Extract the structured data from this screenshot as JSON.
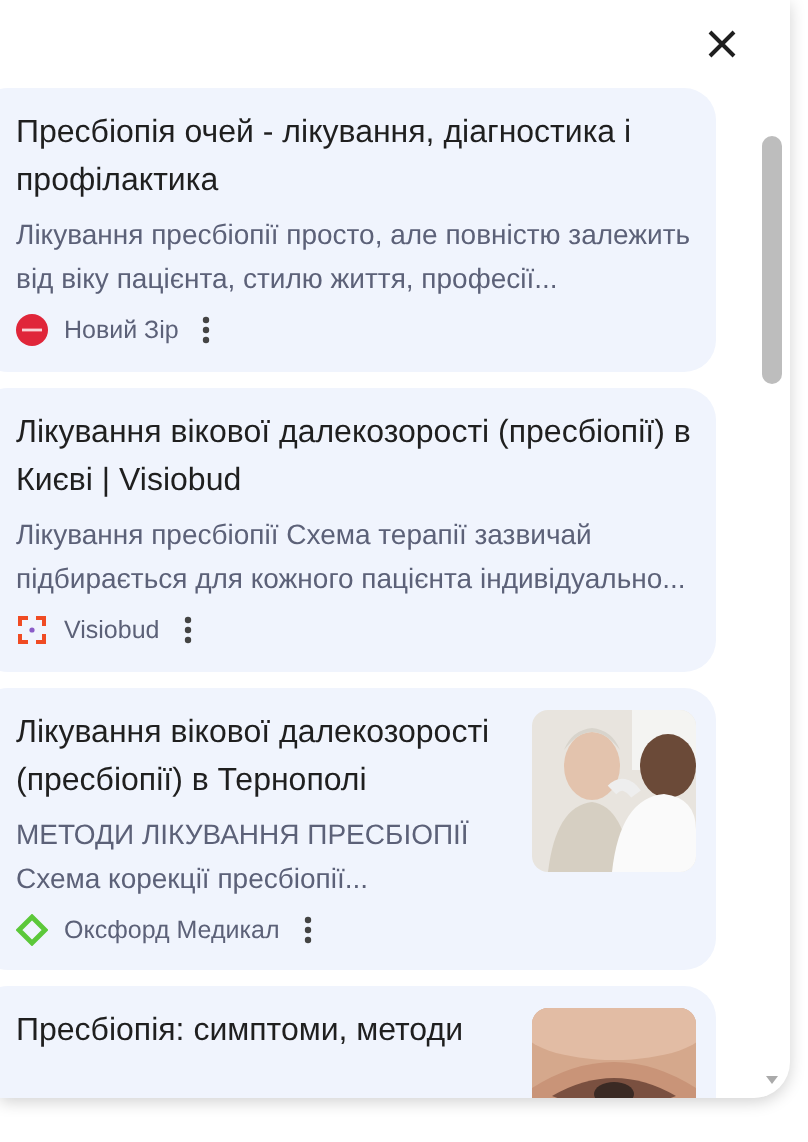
{
  "results": [
    {
      "title": "Пресбіопія очей - лікування, діагностика і профілактика",
      "snippet": [
        "Лікування пресбіопії просто, але повністю залежить від віку пацієнта, стилю життя, професії..."
      ],
      "source": "Новий Зір",
      "kind": "text"
    },
    {
      "title": "Лікування вікової далекозорості (пресбіопії) в Києві | Visiobud",
      "snippet": [
        "Лікування пресбіопії Схема терапії зазвичай підбирається для кожного пацієнта індивідуально..."
      ],
      "source": "Visiobud",
      "kind": "text"
    },
    {
      "title": "Лікування вікової далекозорості (пресбіопії) в Тернополі",
      "snippet": [
        "МЕТОДИ ЛІКУВАННЯ ПРЕСБІОПІЇ",
        "Схема корекції пресбіопії..."
      ],
      "source": "Оксфорд Медикал",
      "kind": "picture"
    },
    {
      "title": "Пресбіопія: симптоми, методи",
      "kind": "picture"
    }
  ]
}
